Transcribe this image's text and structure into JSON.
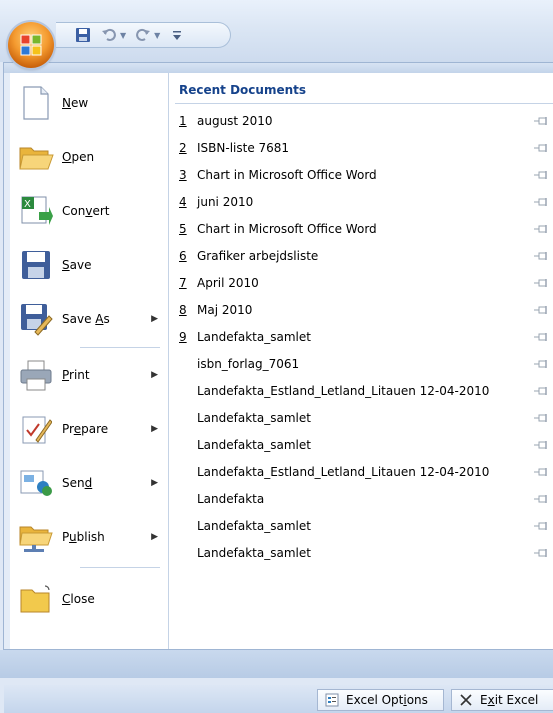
{
  "quick_access": {
    "save_icon": "save-icon",
    "undo_icon": "undo-icon",
    "redo_icon": "redo-icon",
    "customize_icon": "customize-dropdown-icon"
  },
  "commands": [
    {
      "id": "new",
      "pre": "",
      "key": "N",
      "post": "ew",
      "icon": "new-document-icon",
      "submenu": false
    },
    {
      "id": "open",
      "pre": "",
      "key": "O",
      "post": "pen",
      "icon": "open-folder-icon",
      "submenu": false
    },
    {
      "id": "convert",
      "pre": "Con",
      "key": "v",
      "post": "ert",
      "icon": "convert-icon",
      "submenu": false
    },
    {
      "id": "save",
      "pre": "",
      "key": "S",
      "post": "ave",
      "icon": "save-disk-icon",
      "submenu": false
    },
    {
      "id": "save-as",
      "pre": "Save ",
      "key": "A",
      "post": "s",
      "icon": "save-as-icon",
      "submenu": true
    },
    {
      "id": "print",
      "pre": "",
      "key": "P",
      "post": "rint",
      "icon": "printer-icon",
      "submenu": true
    },
    {
      "id": "prepare",
      "pre": "Pr",
      "key": "e",
      "post": "pare",
      "icon": "prepare-icon",
      "submenu": true
    },
    {
      "id": "send",
      "pre": "Sen",
      "key": "d",
      "post": "",
      "icon": "send-icon",
      "submenu": true
    },
    {
      "id": "publish",
      "pre": "P",
      "key": "u",
      "post": "blish",
      "icon": "publish-icon",
      "submenu": true
    },
    {
      "id": "close",
      "pre": "",
      "key": "C",
      "post": "lose",
      "icon": "close-folder-icon",
      "submenu": false
    }
  ],
  "recent": {
    "title": "Recent Documents",
    "items": [
      {
        "num": "1",
        "name": "august 2010"
      },
      {
        "num": "2",
        "name": "ISBN-liste 7681"
      },
      {
        "num": "3",
        "name": "Chart in Microsoft Office Word"
      },
      {
        "num": "4",
        "name": "juni 2010"
      },
      {
        "num": "5",
        "name": "Chart in Microsoft Office Word"
      },
      {
        "num": "6",
        "name": "Grafiker arbejdsliste"
      },
      {
        "num": "7",
        "name": "April 2010"
      },
      {
        "num": "8",
        "name": "Maj 2010"
      },
      {
        "num": "9",
        "name": "Landefakta_samlet"
      },
      {
        "num": "",
        "name": "isbn_forlag_7061"
      },
      {
        "num": "",
        "name": "Landefakta_Estland_Letland_Litauen 12-04-2010"
      },
      {
        "num": "",
        "name": "Landefakta_samlet"
      },
      {
        "num": "",
        "name": "Landefakta_samlet"
      },
      {
        "num": "",
        "name": "Landefakta_Estland_Letland_Litauen 12-04-2010"
      },
      {
        "num": "",
        "name": "Landefakta"
      },
      {
        "num": "",
        "name": "Landefakta_samlet"
      },
      {
        "num": "",
        "name": "Landefakta_samlet"
      }
    ],
    "pin_icon": "pin-icon"
  },
  "bottom": {
    "options": {
      "pre": "Excel Opt",
      "key": "i",
      "post": "ons",
      "icon": "options-icon"
    },
    "exit": {
      "pre": "E",
      "key": "x",
      "post": "it Excel",
      "icon": "exit-x-icon"
    }
  },
  "colors": {
    "accent": "#15428b",
    "frame": "#dfe8f5",
    "orb": "#f49a2f"
  }
}
